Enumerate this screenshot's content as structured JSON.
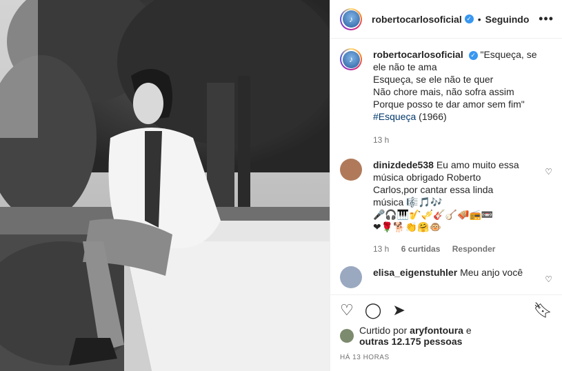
{
  "header": {
    "username": "robertocarlosoficial",
    "verified_glyph": "✓",
    "separator": "•",
    "follow_label": "Seguindo",
    "more_label": "•••"
  },
  "caption": {
    "username": "robertocarlosoficial",
    "line1": "\"Esqueça, se ele não te ama",
    "line2": "Esqueça, se ele não te quer",
    "line3": "Não chore mais, não sofra assim",
    "line4": "Porque posso te dar amor sem fim\"",
    "hashtag": "#Esqueça",
    "year": "(1966)",
    "time": "13 h"
  },
  "comments": [
    {
      "username": "dinizdede538",
      "text": "Eu amo muito essa música obrigado Roberto Carlos,por cantar essa linda música",
      "emojis1": "🎼🎵🎶",
      "emojis2": "🎤🎧🎹🎷🎺🎸🪕🪗📻📼",
      "emojis3": "❤🌹🐕👏🤗🐵",
      "time": "13 h",
      "likes": "6 curtidas",
      "reply": "Responder",
      "avatar_color": "#b07a5a"
    },
    {
      "username": "elisa_eigenstuhler",
      "text": "Meu anjo você",
      "avatar_color": "#9aa8c0"
    }
  ],
  "likes": {
    "prefix": "Curtido por",
    "user": "aryfontoura",
    "mid": "e",
    "others": "outras 12.175 pessoas"
  },
  "posted_ago": "HÁ 13 HORAS",
  "icons": {
    "like": "heart-icon",
    "comment": "comment-icon",
    "share": "share-icon",
    "save": "bookmark-icon",
    "more": "more-icon"
  }
}
